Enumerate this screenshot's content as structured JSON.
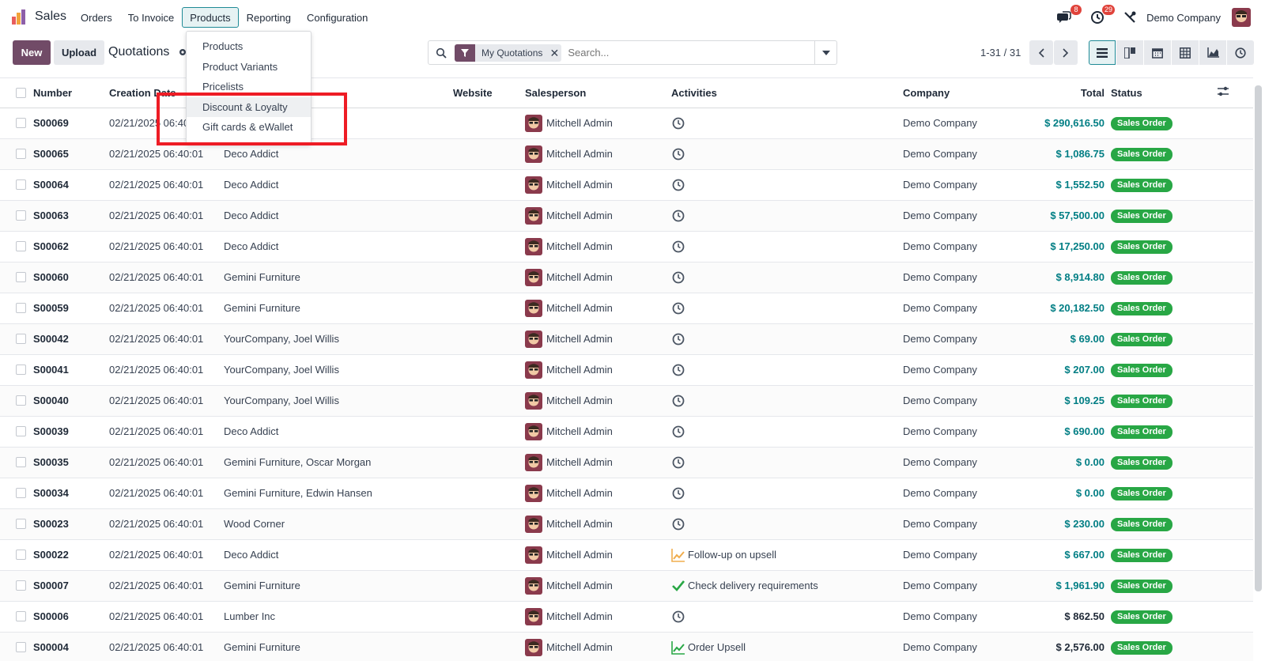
{
  "app": {
    "name": "Sales",
    "brand_color": "#714b67",
    "accent_color": "#017e84"
  },
  "nav": {
    "items": [
      {
        "label": "Orders",
        "active": false
      },
      {
        "label": "To Invoice",
        "active": false
      },
      {
        "label": "Products",
        "active": true
      },
      {
        "label": "Reporting",
        "active": false
      },
      {
        "label": "Configuration",
        "active": false
      }
    ]
  },
  "systray": {
    "messages_badge": "8",
    "activities_badge": "29",
    "company": "Demo Company"
  },
  "control": {
    "new_label": "New",
    "upload_label": "Upload",
    "title": "Quotations",
    "facet_label": "My Quotations",
    "search_placeholder": "Search...",
    "pager": "1-31 / 31"
  },
  "dropdown": {
    "items": [
      "Products",
      "Product Variants",
      "Pricelists",
      "Discount & Loyalty",
      "Gift cards & eWallet"
    ],
    "hover_index": 3
  },
  "table": {
    "headers": {
      "number": "Number",
      "creation_date": "Creation Date",
      "website": "Website",
      "salesperson": "Salesperson",
      "activities": "Activities",
      "company": "Company",
      "total": "Total",
      "status": "Status"
    },
    "rows": [
      {
        "number": "S00069",
        "date": "02/21/2025 06:40:01",
        "customer": "",
        "salesperson": "Mitchell Admin",
        "activity_icon": "clock-icon",
        "activity": "",
        "company": "Demo Company",
        "total": "$ 290,616.50",
        "total_color": "teal",
        "status": "Sales Order"
      },
      {
        "number": "S00065",
        "date": "02/21/2025 06:40:01",
        "customer": "Deco Addict",
        "salesperson": "Mitchell Admin",
        "activity_icon": "clock-icon",
        "activity": "",
        "company": "Demo Company",
        "total": "$ 1,086.75",
        "total_color": "teal",
        "status": "Sales Order"
      },
      {
        "number": "S00064",
        "date": "02/21/2025 06:40:01",
        "customer": "Deco Addict",
        "salesperson": "Mitchell Admin",
        "activity_icon": "clock-icon",
        "activity": "",
        "company": "Demo Company",
        "total": "$ 1,552.50",
        "total_color": "teal",
        "status": "Sales Order"
      },
      {
        "number": "S00063",
        "date": "02/21/2025 06:40:01",
        "customer": "Deco Addict",
        "salesperson": "Mitchell Admin",
        "activity_icon": "clock-icon",
        "activity": "",
        "company": "Demo Company",
        "total": "$ 57,500.00",
        "total_color": "teal",
        "status": "Sales Order"
      },
      {
        "number": "S00062",
        "date": "02/21/2025 06:40:01",
        "customer": "Deco Addict",
        "salesperson": "Mitchell Admin",
        "activity_icon": "clock-icon",
        "activity": "",
        "company": "Demo Company",
        "total": "$ 17,250.00",
        "total_color": "teal",
        "status": "Sales Order"
      },
      {
        "number": "S00060",
        "date": "02/21/2025 06:40:01",
        "customer": "Gemini Furniture",
        "salesperson": "Mitchell Admin",
        "activity_icon": "clock-icon",
        "activity": "",
        "company": "Demo Company",
        "total": "$ 8,914.80",
        "total_color": "teal",
        "status": "Sales Order"
      },
      {
        "number": "S00059",
        "date": "02/21/2025 06:40:01",
        "customer": "Gemini Furniture",
        "salesperson": "Mitchell Admin",
        "activity_icon": "clock-icon",
        "activity": "",
        "company": "Demo Company",
        "total": "$ 20,182.50",
        "total_color": "teal",
        "status": "Sales Order"
      },
      {
        "number": "S00042",
        "date": "02/21/2025 06:40:01",
        "customer": "YourCompany, Joel Willis",
        "salesperson": "Mitchell Admin",
        "activity_icon": "clock-icon",
        "activity": "",
        "company": "Demo Company",
        "total": "$ 69.00",
        "total_color": "teal",
        "status": "Sales Order"
      },
      {
        "number": "S00041",
        "date": "02/21/2025 06:40:01",
        "customer": "YourCompany, Joel Willis",
        "salesperson": "Mitchell Admin",
        "activity_icon": "clock-icon",
        "activity": "",
        "company": "Demo Company",
        "total": "$ 207.00",
        "total_color": "teal",
        "status": "Sales Order"
      },
      {
        "number": "S00040",
        "date": "02/21/2025 06:40:01",
        "customer": "YourCompany, Joel Willis",
        "salesperson": "Mitchell Admin",
        "activity_icon": "clock-icon",
        "activity": "",
        "company": "Demo Company",
        "total": "$ 109.25",
        "total_color": "teal",
        "status": "Sales Order"
      },
      {
        "number": "S00039",
        "date": "02/21/2025 06:40:01",
        "customer": "Deco Addict",
        "salesperson": "Mitchell Admin",
        "activity_icon": "clock-icon",
        "activity": "",
        "company": "Demo Company",
        "total": "$ 690.00",
        "total_color": "teal",
        "status": "Sales Order"
      },
      {
        "number": "S00035",
        "date": "02/21/2025 06:40:01",
        "customer": "Gemini Furniture, Oscar Morgan",
        "salesperson": "Mitchell Admin",
        "activity_icon": "clock-icon",
        "activity": "",
        "company": "Demo Company",
        "total": "$ 0.00",
        "total_color": "teal",
        "status": "Sales Order"
      },
      {
        "number": "S00034",
        "date": "02/21/2025 06:40:01",
        "customer": "Gemini Furniture, Edwin Hansen",
        "salesperson": "Mitchell Admin",
        "activity_icon": "clock-icon",
        "activity": "",
        "company": "Demo Company",
        "total": "$ 0.00",
        "total_color": "teal",
        "status": "Sales Order"
      },
      {
        "number": "S00023",
        "date": "02/21/2025 06:40:01",
        "customer": "Wood Corner",
        "salesperson": "Mitchell Admin",
        "activity_icon": "clock-icon",
        "activity": "",
        "company": "Demo Company",
        "total": "$ 230.00",
        "total_color": "teal",
        "status": "Sales Order"
      },
      {
        "number": "S00022",
        "date": "02/21/2025 06:40:01",
        "customer": "Deco Addict",
        "salesperson": "Mitchell Admin",
        "activity_icon": "chart-up-icon",
        "activity": "Follow-up on upsell",
        "company": "Demo Company",
        "total": "$ 667.00",
        "total_color": "teal",
        "status": "Sales Order"
      },
      {
        "number": "S00007",
        "date": "02/21/2025 06:40:01",
        "customer": "Gemini Furniture",
        "salesperson": "Mitchell Admin",
        "activity_icon": "check-icon",
        "activity": "Check delivery requirements",
        "company": "Demo Company",
        "total": "$ 1,961.90",
        "total_color": "teal",
        "status": "Sales Order"
      },
      {
        "number": "S00006",
        "date": "02/21/2025 06:40:01",
        "customer": "Lumber Inc",
        "salesperson": "Mitchell Admin",
        "activity_icon": "clock-icon",
        "activity": "",
        "company": "Demo Company",
        "total": "$ 862.50",
        "total_color": "black",
        "status": "Sales Order"
      },
      {
        "number": "S00004",
        "date": "02/21/2025 06:40:01",
        "customer": "Gemini Furniture",
        "salesperson": "Mitchell Admin",
        "activity_icon": "chart-up-green-icon",
        "activity": "Order Upsell",
        "company": "Demo Company",
        "total": "$ 2,576.00",
        "total_color": "black",
        "status": "Sales Order"
      }
    ]
  }
}
